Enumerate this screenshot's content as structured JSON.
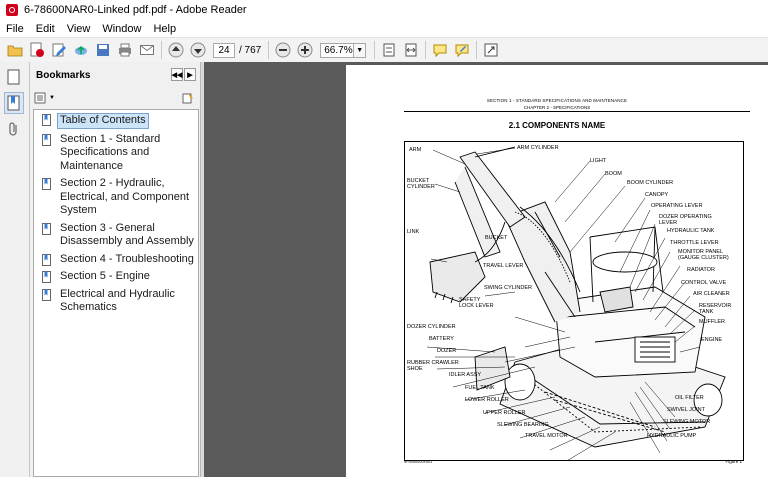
{
  "window": {
    "title": "6-78600NAR0-Linked pdf.pdf - Adobe Reader"
  },
  "menu": [
    "File",
    "Edit",
    "View",
    "Window",
    "Help"
  ],
  "toolbar": {
    "page_current": "24",
    "page_total": "/ 767",
    "zoom": "66.7%"
  },
  "bookmarks": {
    "title": "Bookmarks",
    "items": [
      {
        "label": "Table of Contents",
        "selected": true
      },
      {
        "label": "Section 1 - Standard Specifications and Maintenance"
      },
      {
        "label": "Section 2 - Hydraulic, Electrical, and Component System"
      },
      {
        "label": "Section 3 - General Disassembly and Assembly"
      },
      {
        "label": "Section 4 - Troubleshooting"
      },
      {
        "label": "Section 5 - Engine"
      },
      {
        "label": "Electrical and Hydraulic Schematics"
      }
    ]
  },
  "page": {
    "header1": "SECTION 1 - STANDARD SPECIFICATIONS AND MAINTENANCE",
    "header2": "CHAPTER 2 - SPECIFICATIONS",
    "title": "2.1  COMPONENTS NAME",
    "figure_code": "9P4000000X001",
    "figure_label": "Figure 1",
    "labels": {
      "arm": "ARM",
      "arm_cylinder": "ARM CYLINDER",
      "light": "LIGHT",
      "boom": "BOOM",
      "bucket_cylinder_1": "BUCKET",
      "bucket_cylinder_2": "CYLINDER",
      "boom_cylinder": "BOOM CYLINDER",
      "canopy": "CANOPY",
      "operating_lever": "OPERATING LEVER",
      "dozer_op_lever_1": "DOZER OPERATING",
      "dozer_op_lever_2": "LEVER",
      "hydraulic_tank": "HYDRAULIC TANK",
      "link": "LINK",
      "bucket": "BUCKET",
      "throttle_lever": "THROTTLE LEVER",
      "monitor_panel_1": "MONITOR PANEL",
      "monitor_panel_2": "(GAUGE CLUSTER)",
      "travel_lever": "TRAVEL LEVER",
      "radiator": "RADIATOR",
      "control_valve": "CONTROL VALVE",
      "swing_cylinder": "SWING CYLINDER",
      "air_cleaner": "AIR CLEANER",
      "safety_lock_1": "SAFETY",
      "safety_lock_2": "LOCK LEVER",
      "reservoir_tank_1": "RESERVOIR",
      "reservoir_tank_2": "TANK",
      "muffler": "MUFFLER",
      "dozer_cylinder": "DOZER CYLINDER",
      "battery": "BATTERY",
      "engine": "ENGINE",
      "dozer": "DOZER",
      "rubber_crawler_1": "RUBBER CRAWLER",
      "rubber_crawler_2": "SHOE",
      "idler_assy": "IDLER ASSY",
      "fuel_tank": "FUEL TANK",
      "oil_filter": "OIL FILTER",
      "lower_roller": "LOWER ROLLER",
      "swivel_joint": "SWIVEL JOINT",
      "upper_roller": "UPPER ROLLER",
      "slewing_motor": "SLEWING MOTOR",
      "slewing_bearing": "SLEWING BEARING",
      "travel_motor": "TRAVEL MOTOR",
      "hydraulic_pump": "HYDRAULIC PUMP"
    }
  }
}
